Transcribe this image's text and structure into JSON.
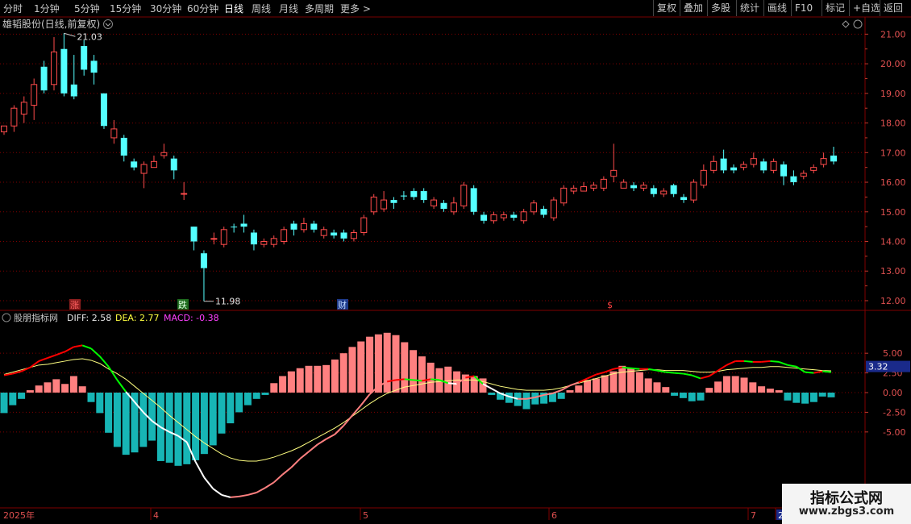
{
  "toolbar": {
    "left": [
      "分时",
      "1分钟",
      "5分钟",
      "15分钟",
      "30分钟",
      "60分钟",
      "日线",
      "周线",
      "月线",
      "多周期",
      "更多 >"
    ],
    "active_index": 6,
    "right": [
      "复权",
      "叠加",
      "多股",
      "统计",
      "画线",
      "F10",
      "标记",
      "+自选",
      "返回"
    ]
  },
  "price_panel": {
    "title": "雄韬股份(日线,前复权)",
    "high_label": "21.03",
    "low_label": "11.98",
    "y_ticks": [
      "21.00",
      "20.00",
      "19.00",
      "18.00",
      "17.00",
      "16.00",
      "15.00",
      "14.00",
      "13.00",
      "12.00"
    ],
    "markers": [
      "涨",
      "跌",
      "财",
      "$"
    ]
  },
  "macd_panel": {
    "name": "股朋指标网",
    "diff_label": "DIFF: 2.58",
    "dea_label": "DEA: 2.77",
    "macd_label": "MACD: -0.38",
    "y_ticks": [
      "5.00",
      "2.50",
      "0.00",
      "-2.50",
      "-5.00"
    ],
    "current_value": "3.32"
  },
  "x_axis": {
    "labels": [
      "2025年",
      "4",
      "5",
      "6",
      "7",
      "2"
    ]
  },
  "watermark": {
    "line1": "指标公式网",
    "line2": "www.zbgs3.com"
  },
  "colors": {
    "up": "#ff4b4b",
    "down": "#54ffff",
    "bar_pos": "#ff8080",
    "bar_neg": "#17b5b5",
    "dea": "#ffff80",
    "diff_up": "#ff0000",
    "diff_mid": "#ff8080",
    "diff_down": "#ffffff",
    "diff_green": "#00ff00",
    "grid": "#800000"
  },
  "chart_data": [
    {
      "type": "candlestick",
      "title": "雄韬股份(日线,前复权)",
      "ylim": [
        11.7,
        21.5
      ],
      "candles": [
        [
          17.7,
          17.9,
          17.9,
          17.6
        ],
        [
          17.9,
          18.5,
          18.6,
          17.7
        ],
        [
          18.3,
          18.7,
          18.9,
          18.0
        ],
        [
          18.6,
          19.3,
          19.5,
          18.1
        ],
        [
          19.9,
          19.1,
          20.1,
          19.0
        ],
        [
          19.3,
          20.4,
          20.9,
          19.1
        ],
        [
          20.5,
          19.0,
          21.03,
          18.9
        ],
        [
          19.3,
          18.9,
          20.3,
          18.8
        ],
        [
          20.6,
          19.8,
          20.8,
          19.6
        ],
        [
          20.1,
          19.7,
          20.3,
          19.3
        ],
        [
          19.0,
          17.9,
          19.0,
          17.8
        ],
        [
          17.5,
          17.8,
          18.1,
          17.3
        ],
        [
          17.5,
          16.9,
          17.6,
          16.7
        ],
        [
          16.7,
          16.5,
          16.8,
          16.4
        ],
        [
          16.3,
          16.6,
          16.7,
          15.8
        ],
        [
          16.5,
          16.7,
          16.9,
          16.5
        ],
        [
          16.9,
          17.0,
          17.3,
          16.8
        ],
        [
          16.8,
          16.4,
          16.9,
          16.1
        ],
        [
          15.6,
          15.62,
          16.0,
          15.4
        ],
        [
          14.5,
          14.0,
          14.5,
          13.7
        ],
        [
          13.6,
          13.1,
          13.7,
          11.98
        ],
        [
          14.1,
          14.1,
          14.3,
          13.9
        ],
        [
          13.9,
          14.4,
          14.5,
          13.8
        ],
        [
          14.5,
          14.48,
          14.6,
          14.3
        ],
        [
          14.6,
          14.5,
          14.9,
          14.3
        ],
        [
          14.3,
          13.9,
          14.4,
          13.7
        ],
        [
          13.9,
          14.0,
          14.1,
          13.8
        ],
        [
          13.9,
          14.1,
          14.2,
          13.8
        ],
        [
          14.0,
          14.4,
          14.5,
          13.9
        ],
        [
          14.6,
          14.4,
          14.7,
          14.2
        ],
        [
          14.4,
          14.6,
          14.8,
          14.3
        ],
        [
          14.6,
          14.4,
          14.7,
          14.3
        ],
        [
          14.2,
          14.4,
          14.5,
          14.1
        ],
        [
          14.3,
          14.2,
          14.4,
          14.1
        ],
        [
          14.3,
          14.1,
          14.4,
          14.0
        ],
        [
          14.1,
          14.3,
          14.4,
          14.0
        ],
        [
          14.3,
          14.8,
          14.9,
          14.2
        ],
        [
          15.0,
          15.5,
          15.6,
          14.9
        ],
        [
          15.1,
          15.4,
          15.7,
          15.0
        ],
        [
          15.4,
          15.3,
          15.5,
          15.1
        ],
        [
          15.55,
          15.52,
          15.7,
          15.4
        ],
        [
          15.7,
          15.5,
          15.8,
          15.4
        ],
        [
          15.7,
          15.4,
          15.8,
          15.3
        ],
        [
          15.2,
          15.4,
          15.5,
          15.1
        ],
        [
          15.3,
          15.1,
          15.4,
          15.0
        ],
        [
          15.0,
          15.3,
          15.5,
          14.9
        ],
        [
          15.2,
          15.9,
          16.0,
          15.1
        ],
        [
          15.8,
          15.0,
          15.9,
          14.9
        ],
        [
          14.9,
          14.7,
          15.0,
          14.6
        ],
        [
          14.7,
          14.9,
          15.0,
          14.6
        ],
        [
          14.8,
          14.9,
          15.0,
          14.7
        ],
        [
          14.9,
          14.8,
          15.0,
          14.7
        ],
        [
          14.7,
          15.0,
          15.1,
          14.6
        ],
        [
          15.0,
          15.3,
          15.4,
          14.9
        ],
        [
          15.1,
          14.9,
          15.2,
          14.8
        ],
        [
          14.8,
          15.4,
          15.5,
          14.7
        ],
        [
          15.3,
          15.8,
          15.9,
          15.2
        ],
        [
          15.7,
          15.8,
          15.9,
          15.6
        ],
        [
          15.7,
          15.85,
          16.0,
          15.7
        ],
        [
          15.8,
          15.9,
          16.0,
          15.7
        ],
        [
          15.8,
          16.1,
          16.2,
          15.7
        ],
        [
          16.2,
          16.4,
          17.3,
          16.0
        ],
        [
          15.8,
          16.0,
          16.1,
          15.8
        ],
        [
          15.9,
          15.8,
          16.0,
          15.7
        ],
        [
          15.8,
          15.9,
          16.0,
          15.7
        ],
        [
          15.8,
          15.6,
          15.9,
          15.5
        ],
        [
          15.6,
          15.7,
          15.8,
          15.5
        ],
        [
          15.9,
          15.6,
          15.95,
          15.5
        ],
        [
          15.5,
          15.4,
          15.6,
          15.3
        ],
        [
          15.4,
          16.0,
          16.1,
          15.3
        ],
        [
          15.9,
          16.4,
          16.6,
          15.8
        ],
        [
          16.4,
          16.7,
          16.9,
          16.3
        ],
        [
          16.8,
          16.4,
          17.1,
          16.3
        ],
        [
          16.5,
          16.4,
          16.6,
          16.3
        ],
        [
          16.5,
          16.6,
          16.7,
          16.4
        ],
        [
          16.6,
          16.8,
          17.0,
          16.5
        ],
        [
          16.7,
          16.4,
          16.8,
          16.3
        ],
        [
          16.4,
          16.7,
          16.8,
          16.3
        ],
        [
          16.6,
          16.2,
          16.7,
          15.9
        ],
        [
          16.2,
          16.0,
          16.4,
          15.9
        ],
        [
          16.2,
          16.3,
          16.4,
          16.1
        ],
        [
          16.4,
          16.5,
          16.6,
          16.3
        ],
        [
          16.6,
          16.8,
          17.0,
          16.5
        ],
        [
          16.9,
          16.7,
          17.2,
          16.6
        ]
      ]
    },
    {
      "type": "macd",
      "name": "股朋指标网",
      "ylim": [
        -8.5,
        8.5
      ],
      "macd": [
        -2.6,
        -1.6,
        -0.8,
        0.3,
        0.9,
        1.3,
        1.7,
        1.1,
        2.1,
        0.8,
        -1.2,
        -2.6,
        -5.1,
        -6.9,
        -7.9,
        -7.6,
        -6.9,
        -6.1,
        -8.7,
        -8.9,
        -9.3,
        -9.1,
        -8.6,
        -7.8,
        -6.7,
        -5.2,
        -3.9,
        -2.5,
        -1.6,
        -0.8,
        -0.3,
        1.2,
        2.1,
        2.7,
        3.1,
        3.4,
        3.4,
        3.5,
        4.2,
        5.0,
        5.8,
        6.5,
        7.1,
        7.4,
        7.6,
        7.3,
        6.4,
        5.4,
        4.6,
        3.8,
        3.1,
        3.3,
        2.7,
        2.3,
        2.1,
        1.8,
        -0.3,
        -0.9,
        -1.3,
        -1.7,
        -2.1,
        -1.5,
        -1.4,
        -1.2,
        -0.8,
        0.3,
        0.9,
        1.6,
        1.8,
        2.2,
        2.7,
        3.4,
        3.1,
        2.6,
        1.8,
        1.3,
        0.7,
        -0.4,
        -0.7,
        -1.1,
        -1.0,
        0.6,
        1.4,
        2.1,
        2.1,
        1.9,
        1.3,
        0.8,
        0.5,
        0.3,
        -1.0,
        -1.3,
        -1.4,
        -1.2,
        -0.5,
        -0.6
      ],
      "diff": [
        2.2,
        2.4,
        2.7,
        3.2,
        4.0,
        4.4,
        4.8,
        5.2,
        5.8,
        6.0,
        5.6,
        4.6,
        3.3,
        1.6,
        0.1,
        -1.2,
        -2.5,
        -3.6,
        -4.4,
        -5.0,
        -5.5,
        -6.3,
        -8.8,
        -10.8,
        -12.2,
        -13.0,
        -13.3,
        -13.2,
        -13.0,
        -12.7,
        -12.1,
        -11.4,
        -10.4,
        -9.5,
        -8.4,
        -7.5,
        -6.6,
        -5.9,
        -5.3,
        -4.2,
        -2.9,
        -1.6,
        -0.2,
        0.8,
        1.4,
        1.6,
        1.7,
        1.6,
        1.5,
        1.7,
        1.6,
        1.2,
        1.1,
        1.9,
        2.1,
        1.1,
        0.5,
        -0.1,
        -0.5,
        -0.8,
        -0.8,
        -0.6,
        -0.3,
        -0.1,
        0.3,
        0.9,
        1.3,
        1.8,
        2.3,
        2.6,
        3.0,
        3.2,
        3.1,
        3.0,
        3.0,
        2.8,
        2.6,
        2.5,
        2.4,
        2.2,
        1.8,
        2.1,
        2.8,
        3.5,
        4.0,
        4.0,
        3.9,
        3.9,
        4.0,
        3.9,
        3.5,
        3.3,
        2.6,
        2.5,
        2.7,
        2.6
      ],
      "dea": [
        2.3,
        2.6,
        2.9,
        3.2,
        3.5,
        3.6,
        3.8,
        4.0,
        4.2,
        4.3,
        4.1,
        3.7,
        3.0,
        2.4,
        1.7,
        0.8,
        -0.1,
        -1.0,
        -1.9,
        -2.9,
        -3.8,
        -4.7,
        -5.6,
        -6.4,
        -7.1,
        -7.8,
        -8.3,
        -8.6,
        -8.7,
        -8.7,
        -8.5,
        -8.2,
        -7.8,
        -7.4,
        -6.9,
        -6.3,
        -5.7,
        -5.1,
        -4.5,
        -3.8,
        -3.0,
        -2.2,
        -1.4,
        -0.7,
        -0.1,
        0.3,
        0.7,
        0.9,
        1.1,
        1.3,
        1.4,
        1.5,
        1.6,
        1.6,
        1.6,
        1.4,
        1.1,
        0.8,
        0.6,
        0.4,
        0.3,
        0.3,
        0.3,
        0.4,
        0.6,
        0.9,
        1.2,
        1.5,
        1.8,
        2.1,
        2.4,
        2.6,
        2.7,
        2.8,
        2.9,
        2.9,
        2.8,
        2.8,
        2.8,
        2.7,
        2.6,
        2.6,
        2.7,
        2.9,
        3.0,
        3.1,
        3.2,
        3.2,
        3.3,
        3.3,
        3.2,
        3.1,
        3.0,
        2.9,
        2.8,
        2.77
      ]
    }
  ]
}
